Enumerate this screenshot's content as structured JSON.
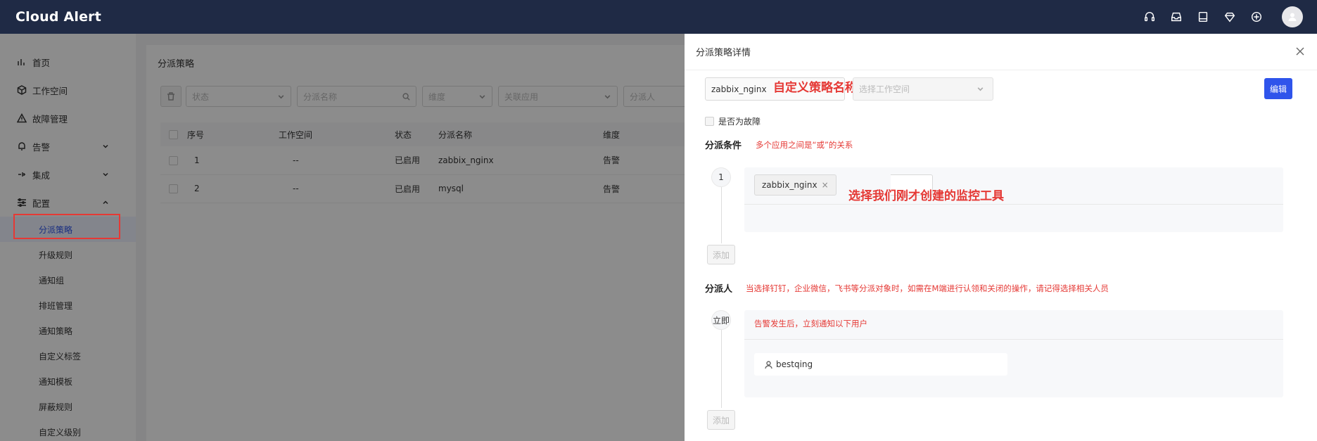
{
  "app": {
    "brand": "Cloud Alert"
  },
  "topbar": {
    "icons": [
      "headset-icon",
      "inbox-icon",
      "book-icon",
      "diamond-icon",
      "globe-icon",
      "avatar-icon"
    ]
  },
  "sidebar": {
    "items": [
      {
        "label": "首页",
        "icon": "chart-icon"
      },
      {
        "label": "工作空间",
        "icon": "cube-icon"
      },
      {
        "label": "故障管理",
        "icon": "warning-icon"
      },
      {
        "label": "告警",
        "icon": "bell-icon",
        "expandable": true
      },
      {
        "label": "集成",
        "icon": "plug-icon",
        "expandable": true
      },
      {
        "label": "配置",
        "icon": "sliders-icon",
        "expanded": true
      }
    ],
    "sub_items": [
      {
        "label": "分派策略",
        "active": true
      },
      {
        "label": "升级规则"
      },
      {
        "label": "通知组"
      },
      {
        "label": "排班管理"
      },
      {
        "label": "通知策略"
      },
      {
        "label": "自定义标签"
      },
      {
        "label": "通知模板"
      },
      {
        "label": "屏蔽规则"
      },
      {
        "label": "自定义级别"
      }
    ]
  },
  "main": {
    "title": "分派策略",
    "filters": {
      "status_placeholder": "状态",
      "name_placeholder": "分派名称",
      "dimension_placeholder": "维度",
      "app_placeholder": "关联应用",
      "assignee_placeholder": "分派人"
    },
    "table": {
      "headers": [
        "序号",
        "工作空间",
        "状态",
        "分派名称",
        "维度"
      ],
      "rows": [
        {
          "index": "1",
          "workspace": "--",
          "status": "已启用",
          "name": "zabbix_nginx",
          "dimension": "告警"
        },
        {
          "index": "2",
          "workspace": "--",
          "status": "已启用",
          "name": "mysql",
          "dimension": "告警"
        }
      ]
    }
  },
  "drawer": {
    "title": "分派策略详情",
    "name_value": "zabbix_nginx",
    "name_annotation": "自定义策略名称",
    "workspace_placeholder": "选择工作空间",
    "edit_label": "编辑",
    "fault_label": "是否为故障",
    "conditions": {
      "title": "分派条件",
      "hint": "多个应用之间是“或”的关系",
      "step": "1",
      "tag": "zabbix_nginx",
      "tag_close": "×",
      "annotation": "选择我们刚才创建的监控工具",
      "add_label": "添加"
    },
    "assignee": {
      "title": "分派人",
      "hint": "当选择钉钉，企业微信，飞书等分派对象时，如需在M端进行认领和关闭的操作，请记得选择相关人员",
      "step": "立即",
      "box_hint": "告警发生后，立刻通知以下用户",
      "user": "bestqing",
      "add_label": "添加"
    }
  }
}
